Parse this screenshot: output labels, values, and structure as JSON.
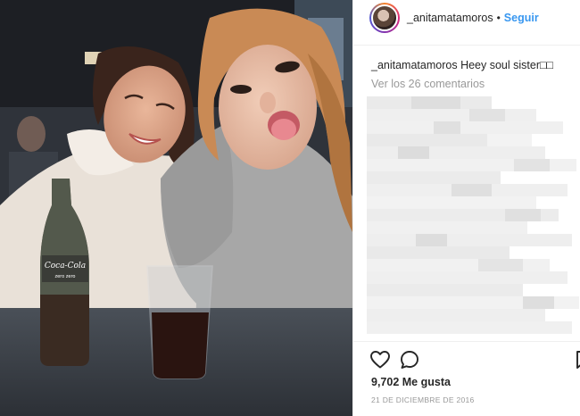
{
  "post": {
    "username": "_anitamatamoros",
    "dot": "•",
    "follow_label": "Seguir",
    "caption_user": "_anitamatamoros",
    "caption_text": "Heey soul sister□□",
    "view_comments": "Ver los 26 comentarios",
    "likes": "9,702 Me gusta",
    "date": "21 DE DICIEMBRE DE 2016"
  },
  "photo": {
    "bottle_brand": "Coca-Cola",
    "bottle_sub": "zero zero"
  },
  "icons": {
    "like": "heart-icon",
    "comment": "comment-bubble-icon",
    "save": "bookmark-icon"
  },
  "colors": {
    "link": "#3897f0",
    "muted": "#999999",
    "text": "#262626"
  }
}
